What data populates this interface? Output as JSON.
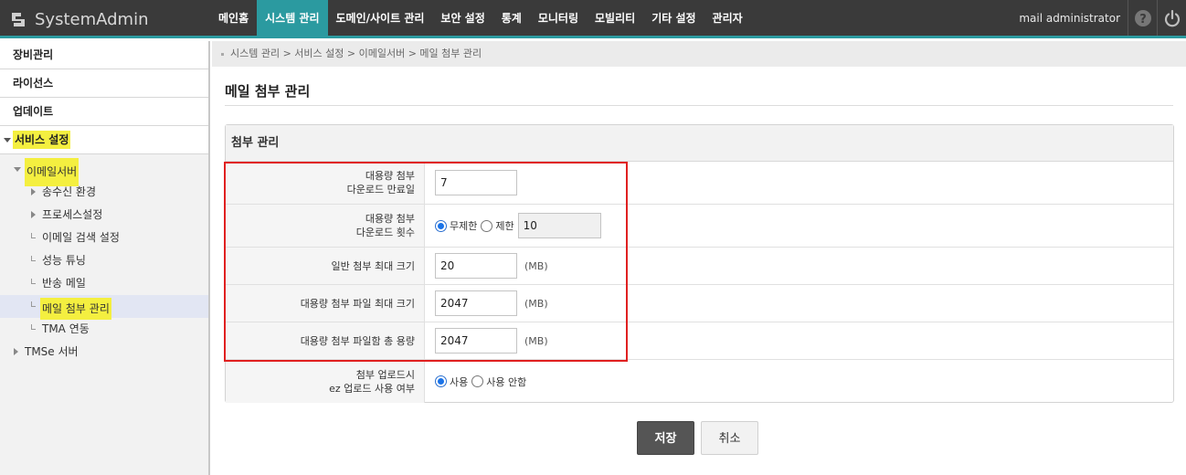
{
  "app": {
    "title": "SystemAdmin"
  },
  "nav": [
    "메인홈",
    "시스템 관리",
    "도메인/사이트 관리",
    "보안 설정",
    "통계",
    "모니터링",
    "모빌리티",
    "기타 설정",
    "관리자"
  ],
  "user": "mail administrator",
  "sidebar": {
    "top_items": [
      "장비관리",
      "라이선스",
      "업데이트"
    ],
    "section": "서비스 설정",
    "group": "이메일서버",
    "children": [
      "송수신 환경",
      "프로세스설정",
      "이메일 검색 설정",
      "성능 튜닝",
      "반송 메일",
      "메일 첨부 관리",
      "TMA 연동"
    ],
    "selected": "메일 첨부 관리",
    "last": "TMSe 서버"
  },
  "breadcrumb": "시스템 관리 > 서비스 설정 > 이메일서버 > 메일 첨부 관리",
  "page_title": "메일 첨부 관리",
  "panel": {
    "title": "첨부 관리",
    "rows": {
      "expire": {
        "label1": "대용량 첨부",
        "label2": "다운로드 만료일",
        "value": "7"
      },
      "count": {
        "label1": "대용량 첨부",
        "label2": "다운로드 횟수",
        "opt_unlimited": "무제한",
        "opt_limit": "제한",
        "selected": "무제한",
        "value": "10"
      },
      "normal_max": {
        "label": "일반 첨부 최대 크기",
        "value": "20",
        "unit": "(MB)"
      },
      "large_file_max": {
        "label": "대용량 첨부 파일 최대 크기",
        "value": "2047",
        "unit": "(MB)"
      },
      "large_total": {
        "label": "대용량 첨부 파일함 총 용량",
        "value": "2047",
        "unit": "(MB)"
      },
      "ez_upload": {
        "label1": "첨부 업로드시",
        "label2": "ez 업로드 사용 여부",
        "opt_use": "사용",
        "opt_nouse": "사용 안함",
        "selected": "사용"
      }
    }
  },
  "buttons": {
    "save": "저장",
    "cancel": "취소"
  },
  "colors": {
    "accent": "#2b9aa0",
    "highlight": "#f4ef40",
    "annotation": "#e02020"
  }
}
